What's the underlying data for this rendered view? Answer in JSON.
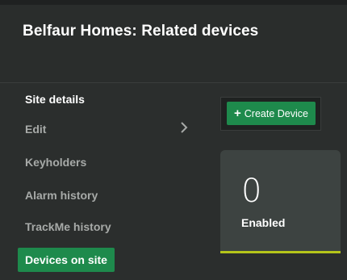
{
  "header": {
    "title": "Belfaur Homes: Related devices"
  },
  "sidebar": {
    "items": [
      {
        "label": "Site details"
      },
      {
        "label": "Edit"
      },
      {
        "label": "Keyholders"
      },
      {
        "label": "Alarm history"
      },
      {
        "label": "TrackMe history"
      },
      {
        "label": "Devices on site"
      }
    ]
  },
  "actions": {
    "create_icon": "+",
    "create_label": "Create Device"
  },
  "stat": {
    "value": "0",
    "label": "Enabled"
  },
  "colors": {
    "background": "#2b2e2d",
    "accent_green": "#1e8a4c",
    "card_bg": "#3d4341",
    "card_bar": "#b5c51a"
  },
  "icons": {
    "edit_chevron": "chevron-right-icon",
    "create": "plus-icon"
  }
}
